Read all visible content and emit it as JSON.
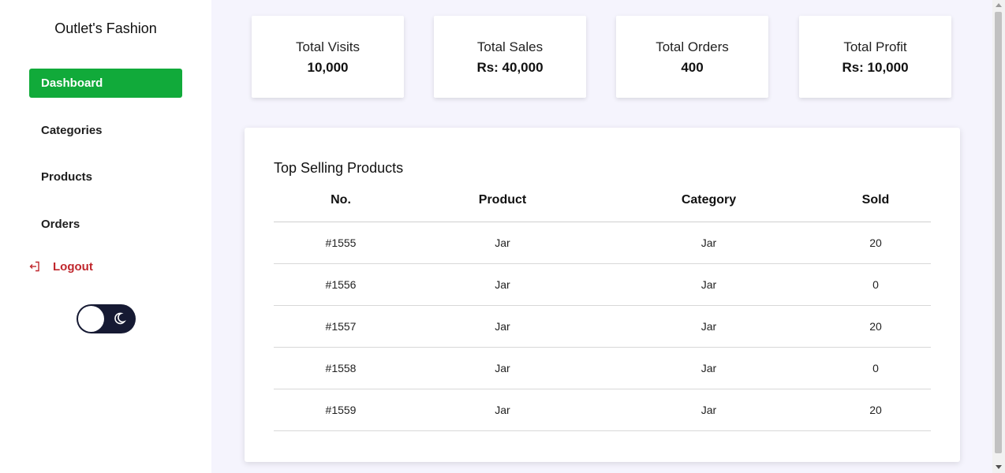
{
  "brand": "Outlet's Fashion",
  "sidebar": {
    "items": [
      {
        "label": "Dashboard",
        "active": true
      },
      {
        "label": "Categories",
        "active": false
      },
      {
        "label": "Products",
        "active": false
      },
      {
        "label": "Orders",
        "active": false
      }
    ],
    "logout_label": "Logout",
    "logout_color": "#c0272d",
    "active_color": "#11aa3a",
    "toggle_icon": "moon-icon"
  },
  "stats": [
    {
      "label": "Total Visits",
      "value": "10,000"
    },
    {
      "label": "Total Sales",
      "value": "Rs: 40,000"
    },
    {
      "label": "Total Orders",
      "value": "400"
    },
    {
      "label": "Total Profit",
      "value": "Rs: 10,000"
    }
  ],
  "table": {
    "title": "Top Selling Products",
    "headers": [
      "No.",
      "Product",
      "Category",
      "Sold"
    ],
    "rows": [
      [
        "#1555",
        "Jar",
        "Jar",
        "20"
      ],
      [
        "#1556",
        "Jar",
        "Jar",
        "0"
      ],
      [
        "#1557",
        "Jar",
        "Jar",
        "20"
      ],
      [
        "#1558",
        "Jar",
        "Jar",
        "0"
      ],
      [
        "#1559",
        "Jar",
        "Jar",
        "20"
      ]
    ]
  }
}
